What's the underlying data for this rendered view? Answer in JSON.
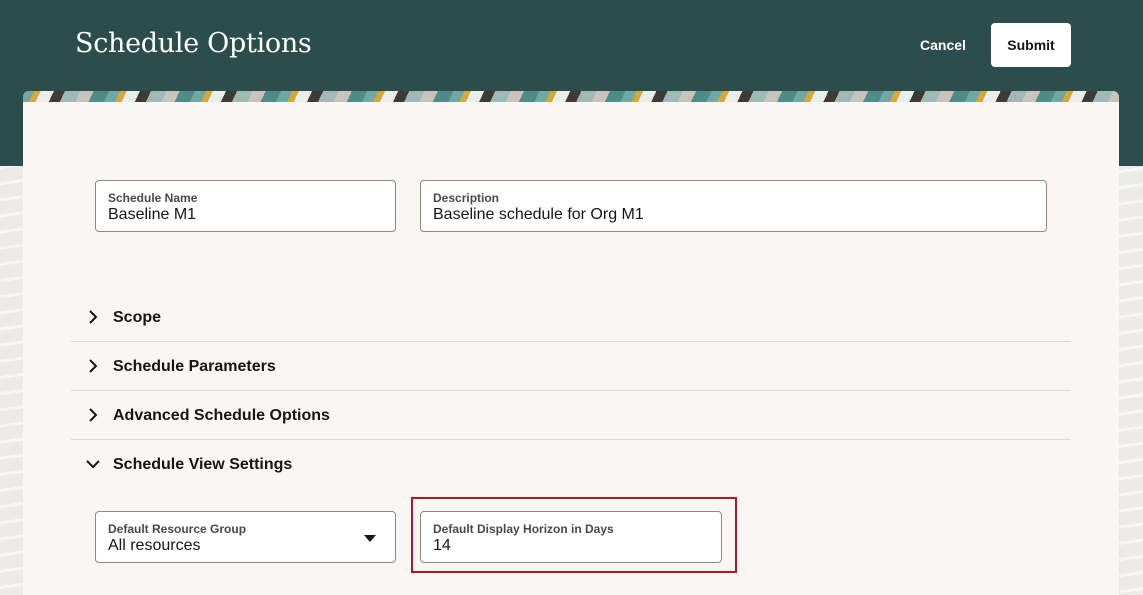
{
  "header": {
    "title": "Schedule Options",
    "cancel_label": "Cancel",
    "submit_label": "Submit"
  },
  "fields": {
    "schedule_name": {
      "label": "Schedule Name",
      "value": "Baseline M1"
    },
    "description": {
      "label": "Description",
      "value": "Baseline schedule for Org M1"
    }
  },
  "sections": [
    {
      "title": "Scope",
      "expanded": false
    },
    {
      "title": "Schedule Parameters",
      "expanded": false
    },
    {
      "title": "Advanced Schedule Options",
      "expanded": false
    },
    {
      "title": "Schedule View Settings",
      "expanded": true
    }
  ],
  "view_settings": {
    "resource_group": {
      "label": "Default Resource Group",
      "value": "All resources"
    },
    "display_horizon": {
      "label": "Default Display Horizon in Days",
      "value": "14"
    }
  },
  "colors": {
    "header_bg": "#2b4d4b",
    "highlight": "#b0182a"
  },
  "icons": {
    "collapsed": "chevron-right-icon",
    "expanded": "chevron-down-icon",
    "dropdown": "caret-down-icon"
  }
}
